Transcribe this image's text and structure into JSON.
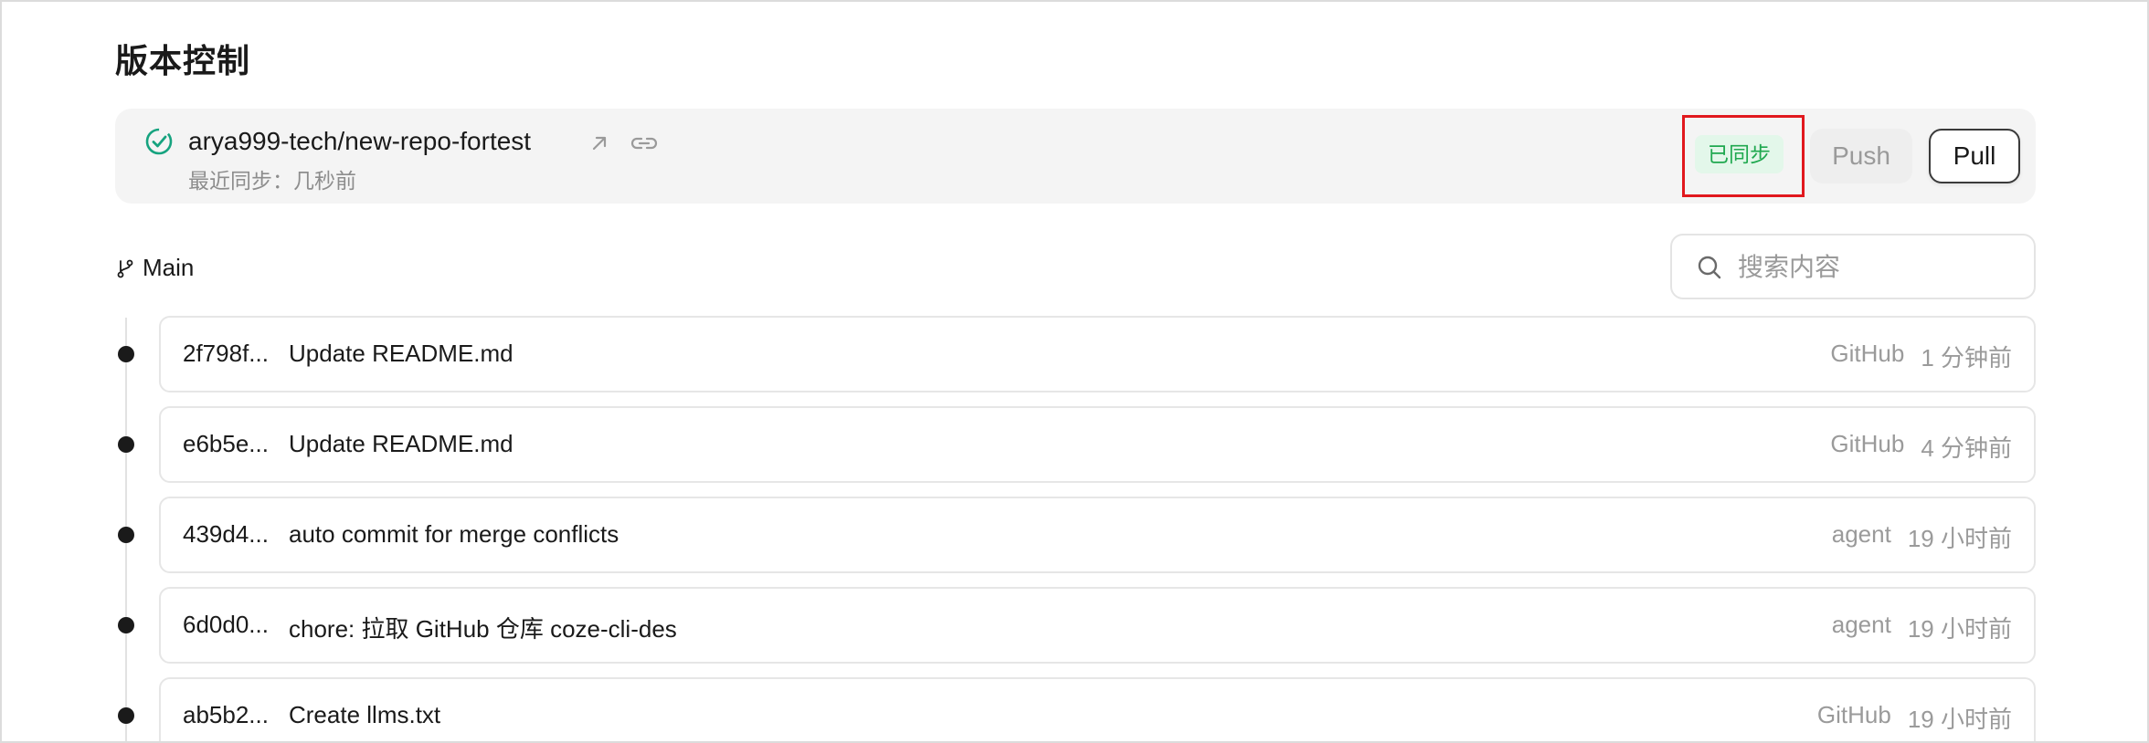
{
  "page": {
    "title": "版本控制"
  },
  "repo": {
    "name": "arya999-tech/new-repo-fortest",
    "last_sync": "最近同步：几秒前",
    "status_badge": "已同步",
    "push_label": "Push",
    "pull_label": "Pull",
    "check_icon": "check-circle-icon",
    "external_icon": "external-link-icon",
    "link_icon": "link-icon"
  },
  "branch": {
    "name": "Main",
    "icon": "git-branch-icon"
  },
  "search": {
    "placeholder": "搜索内容",
    "value": "",
    "icon": "search-icon"
  },
  "commits": [
    {
      "hash": "2f798f...",
      "message": "Update README.md",
      "author": "GitHub",
      "time": "1 分钟前"
    },
    {
      "hash": "e6b5e...",
      "message": "Update README.md",
      "author": "GitHub",
      "time": "4 分钟前"
    },
    {
      "hash": "439d4...",
      "message": "auto commit for merge conflicts",
      "author": "agent",
      "time": "19 小时前"
    },
    {
      "hash": "6d0d0...",
      "message": "chore: 拉取 GitHub 仓库 coze-cli-des",
      "author": "agent",
      "time": "19 小时前"
    },
    {
      "hash": "ab5b2...",
      "message": "Create llms.txt",
      "author": "GitHub",
      "time": "19 小时前"
    }
  ],
  "colors": {
    "accent_green": "#1fa84f",
    "badge_bg": "#e3f7ea",
    "highlight_red": "#e1181d",
    "check_teal": "#16a37f"
  }
}
